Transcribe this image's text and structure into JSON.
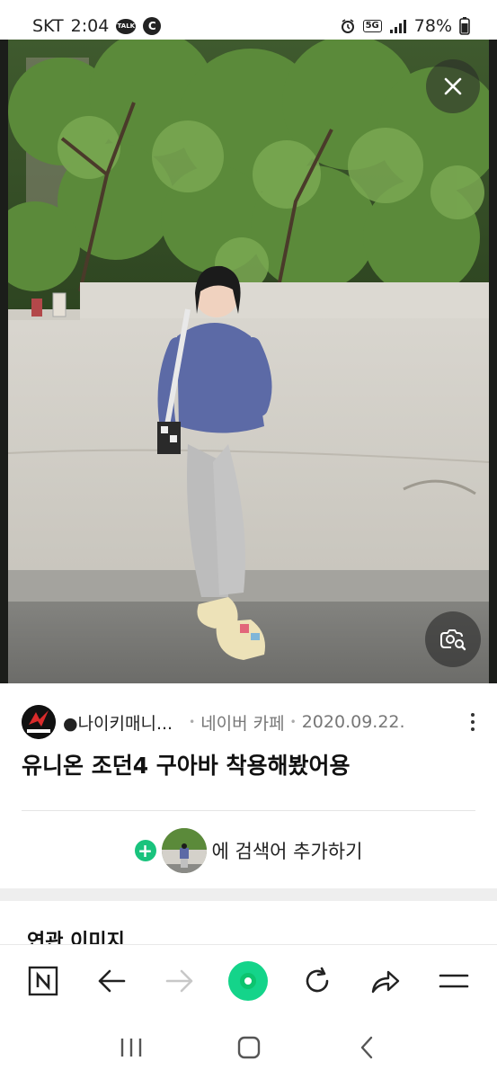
{
  "status_bar": {
    "carrier": "SKT",
    "time": "2:04",
    "talk_badge": "TALK",
    "c_badge": "C",
    "network": "5G",
    "battery": "78%",
    "icons": [
      "talk-icon",
      "c-icon",
      "alarm-icon",
      "5g-icon",
      "signal-icon",
      "battery-icon"
    ]
  },
  "viewer": {
    "close_icon": "close-icon",
    "lens_icon": "image-search-icon"
  },
  "source": {
    "name": "●나이키매니...",
    "site": "네이버 카페",
    "date": "2020.09.22.",
    "separator": "•"
  },
  "post": {
    "title": "유니온 조던4 구아바 착용해봤어용"
  },
  "add_search": {
    "label": "에 검색어 추가하기",
    "plus": "+"
  },
  "related": {
    "title": "연관 이미지"
  },
  "toolbar": {
    "items": [
      "n-home-icon",
      "back-arrow-icon",
      "forward-arrow-icon",
      "green-dot-icon",
      "refresh-icon",
      "share-icon",
      "menu-icon"
    ],
    "n_label": "N"
  },
  "nav": {
    "items": [
      "recent-apps-icon",
      "home-icon",
      "back-icon"
    ]
  },
  "colors": {
    "accent_green": "#14d48a",
    "plus_green": "#19c37d"
  }
}
